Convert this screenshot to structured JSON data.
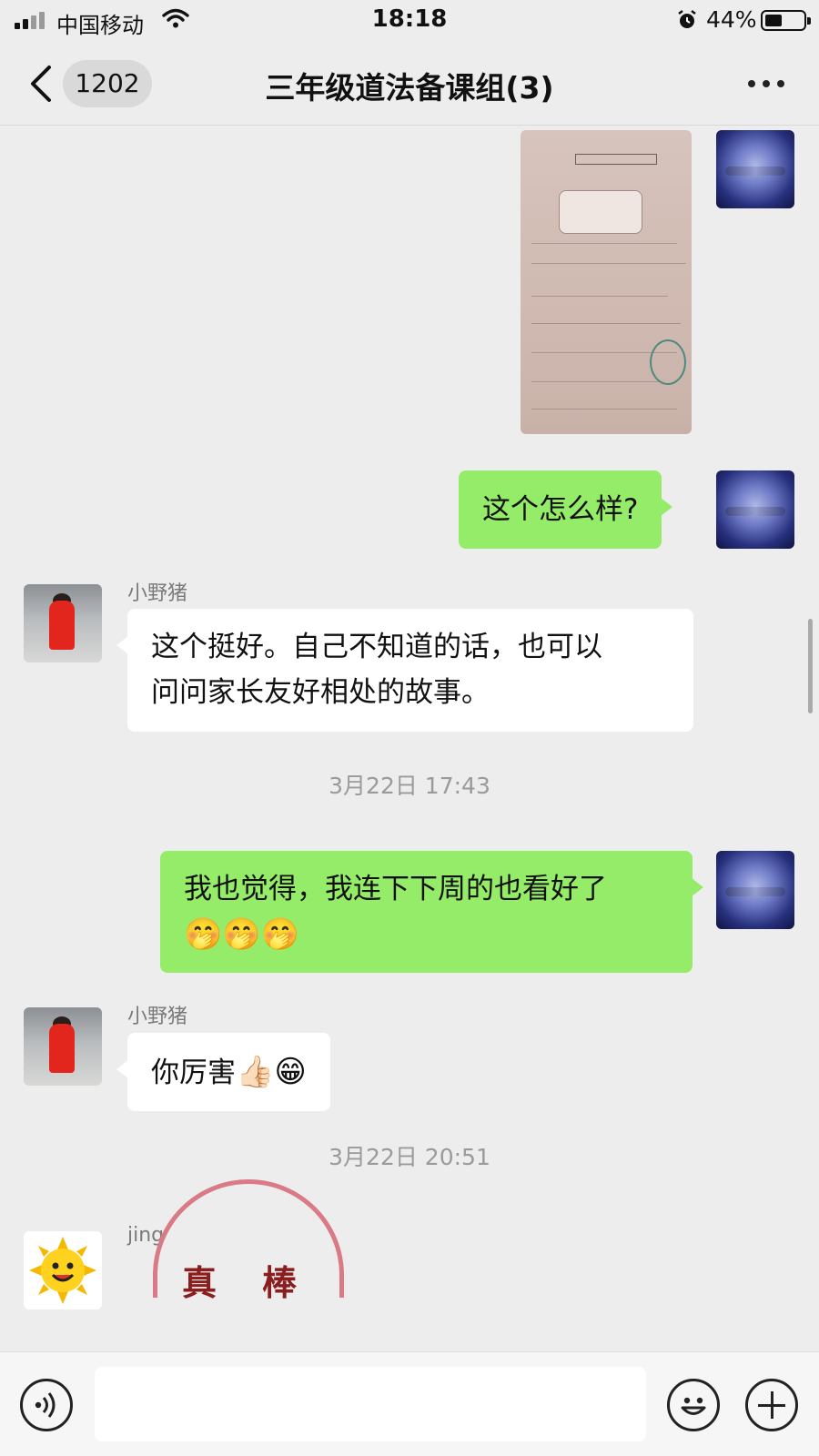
{
  "status_bar": {
    "carrier": "中国移动",
    "time": "18:18",
    "battery_percent": "44%",
    "battery_level": 0.44,
    "icons": [
      "signal-icon",
      "wifi-icon",
      "alarm-icon",
      "battery-icon"
    ]
  },
  "nav": {
    "back_icon": "chevron-left-icon",
    "unread_count": "1202",
    "title": "三年级道法备课组(3)",
    "more_icon": "more-icon"
  },
  "messages": [
    {
      "type": "image",
      "side": "right",
      "sender": "self"
    },
    {
      "type": "text",
      "side": "right",
      "sender": "self",
      "text": "这个怎么样?"
    },
    {
      "type": "text",
      "side": "left",
      "sender": "小野猪",
      "line1": "这个挺好。自己不知道的话，也可以",
      "line2": "问问家长友好相处的故事。"
    },
    {
      "type": "time",
      "text": "3月22日 17:43"
    },
    {
      "type": "text",
      "side": "right",
      "sender": "self",
      "line1": "我也觉得，我连下下周的也看好了",
      "emoji": "🤭🤭🤭"
    },
    {
      "type": "text",
      "side": "left",
      "sender": "小野猪",
      "text": "你厉害",
      "emoji": "👍🏻😁"
    },
    {
      "type": "time",
      "text": "3月22日 20:51"
    },
    {
      "type": "sticker",
      "side": "left",
      "sender": "jing",
      "text": "真棒"
    }
  ],
  "colors": {
    "background": "#ededed",
    "self_bubble": "#95ec69",
    "other_bubble": "#ffffff",
    "timestamp": "#9a9a9a"
  },
  "input_bar": {
    "voice_icon": "voice-icon",
    "emoji_icon": "emoji-icon",
    "plus_icon": "plus-icon"
  }
}
